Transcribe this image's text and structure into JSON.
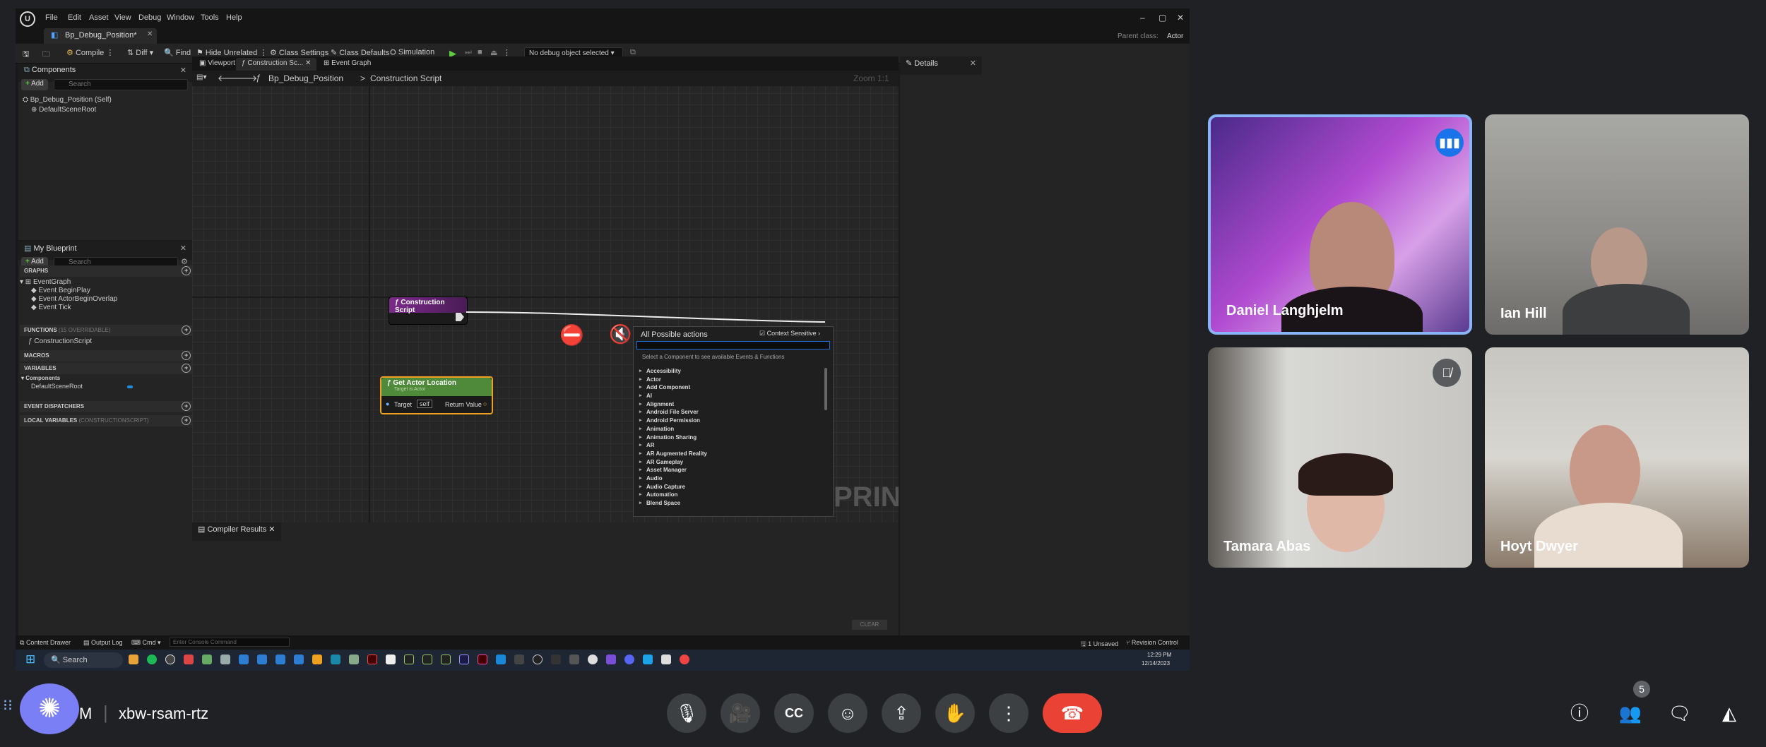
{
  "ue": {
    "logo": "U",
    "menu": [
      "File",
      "Edit",
      "Asset",
      "View",
      "Debug",
      "Window",
      "Tools",
      "Help"
    ],
    "doc_tab": "Bp_Debug_Position*",
    "parent_class_label": "Parent class:",
    "parent_class_value": "Actor",
    "toolbar": {
      "compile": "Compile",
      "diff": "Diff",
      "find": "Find",
      "hide_unrelated": "Hide Unrelated",
      "class_settings": "Class Settings",
      "class_defaults": "Class Defaults",
      "simulation": "Simulation",
      "debug_select": "No debug object selected"
    },
    "components": {
      "title": "Components",
      "add": "Add",
      "search": "Search",
      "self": "Bp_Debug_Position (Self)",
      "root": "DefaultSceneRoot"
    },
    "my_blueprint": {
      "title": "My Blueprint",
      "add": "Add",
      "search": "Search",
      "graphs": "GRAPHS",
      "event_graph": "EventGraph",
      "events": [
        "Event BeginPlay",
        "Event ActorBeginOverlap",
        "Event Tick"
      ],
      "functions": "FUNCTIONS",
      "functions_count": "(15 OVERRIDABLE)",
      "construction_script": "ConstructionScript",
      "macros": "MACROS",
      "variables": "VARIABLES",
      "components": "Components",
      "default_scene_root": "DefaultSceneRoot",
      "event_dispatchers": "EVENT DISPATCHERS",
      "local_variables": "LOCAL VARIABLES",
      "local_variables_sub": "(CONSTRUCTIONSCRIPT)"
    },
    "graph_tabs": [
      "Viewport",
      "Construction Sc...",
      "Event Graph"
    ],
    "breadcrumb": {
      "bp": "Bp_Debug_Position",
      "sep": ">",
      "graph": "Construction Script",
      "zoom": "Zoom 1:1"
    },
    "nodes": {
      "construction": "Construction Script",
      "get_actor_location": "Get Actor Location",
      "target_is_actor": "Target is Actor",
      "target": "Target",
      "self": "self",
      "return_value": "Return Value"
    },
    "context_menu": {
      "title": "All Possible actions",
      "context_sensitive": "Context Sensitive",
      "hint": "Select a Component to see available Events & Functions",
      "items": [
        "Accessibility",
        "Actor",
        "Add Component",
        "AI",
        "Alignment",
        "Android File Server",
        "Android Permission",
        "Animation",
        "Animation Sharing",
        "AR",
        "AR Augmented Reality",
        "AR Gameplay",
        "Asset Manager",
        "Audio",
        "Audio Capture",
        "Automation",
        "Blend Space"
      ]
    },
    "watermark": "PRINT",
    "details": "Details",
    "compiler_results": "Compiler Results",
    "clear": "CLEAR",
    "status": {
      "content_drawer": "Content Drawer",
      "output_log": "Output Log",
      "cmd": "Cmd",
      "console_placeholder": "Enter Console Command",
      "unsaved": "1 Unsaved",
      "revision": "Revision Control"
    }
  },
  "taskbar": {
    "search": "Search",
    "time": "12:29 PM",
    "date": "12/14/2023"
  },
  "meeting": {
    "participants": [
      {
        "name": "Daniel Langhjelm",
        "speaking": true
      },
      {
        "name": "Ian Hill",
        "speaking": false
      },
      {
        "name": "Tamara Abas",
        "muted": true
      },
      {
        "name": "Hoyt Dwyer",
        "muted": false
      }
    ],
    "time_fragment": "M",
    "meeting_code": "xbw-rsam-rtz",
    "people_count": "5",
    "colors": {
      "speaking_border": "#8ab4f8",
      "end_call": "#ea4335",
      "activity_button": "#7b7ff5"
    }
  }
}
